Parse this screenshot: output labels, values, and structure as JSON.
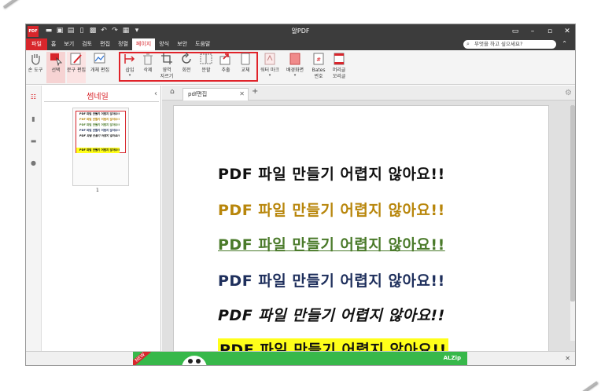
{
  "titlebar": {
    "logo": "PDF",
    "title": "알PDF"
  },
  "menu": {
    "items": [
      "파일",
      "홈",
      "보기",
      "검토",
      "편집",
      "정렬",
      "페이지",
      "양식",
      "보안",
      "도움말"
    ],
    "search_placeholder": "무엇을 하고 싶으세요?"
  },
  "ribbon": {
    "hand": "손 도구",
    "select": "선택",
    "text_edit": "문구 편집",
    "object_edit": "개체 편집",
    "insert": "삽입",
    "delete": "삭제",
    "crop_1": "영역",
    "crop_2": "자르기",
    "rotate": "회전",
    "split": "분할",
    "extract": "추출",
    "replace": "교체",
    "watermark": "워터 마크",
    "background": "배경화면",
    "bates_1": "Bates",
    "bates_2": "번호",
    "header_1": "머리글",
    "header_2": "꼬리글"
  },
  "thumbnails": {
    "title": "썸네일",
    "page_number": "1"
  },
  "tabs": {
    "doc_tab": "pdf편집"
  },
  "document": {
    "lines": [
      "PDF 파일 만들기 어렵지 않아요!!",
      "PDF 파일 만들기 어렵지 않아요!!",
      "PDF 파일 만들기 어렵지 않아요!!",
      "PDF 파일 만들기 어렵지 않아요!!",
      "PDF 파일 만들기 어렵지 않아요!!",
      "PDF 파일 만들기 어렵지 않아요!!"
    ]
  },
  "ad": {
    "badge": "NEW",
    "brand": "ALZip"
  },
  "colors": {
    "accent": "#d8262c",
    "titlebar": "#3c3c3c",
    "highlight": "#ffff1a",
    "ad_green": "#37b84a"
  }
}
